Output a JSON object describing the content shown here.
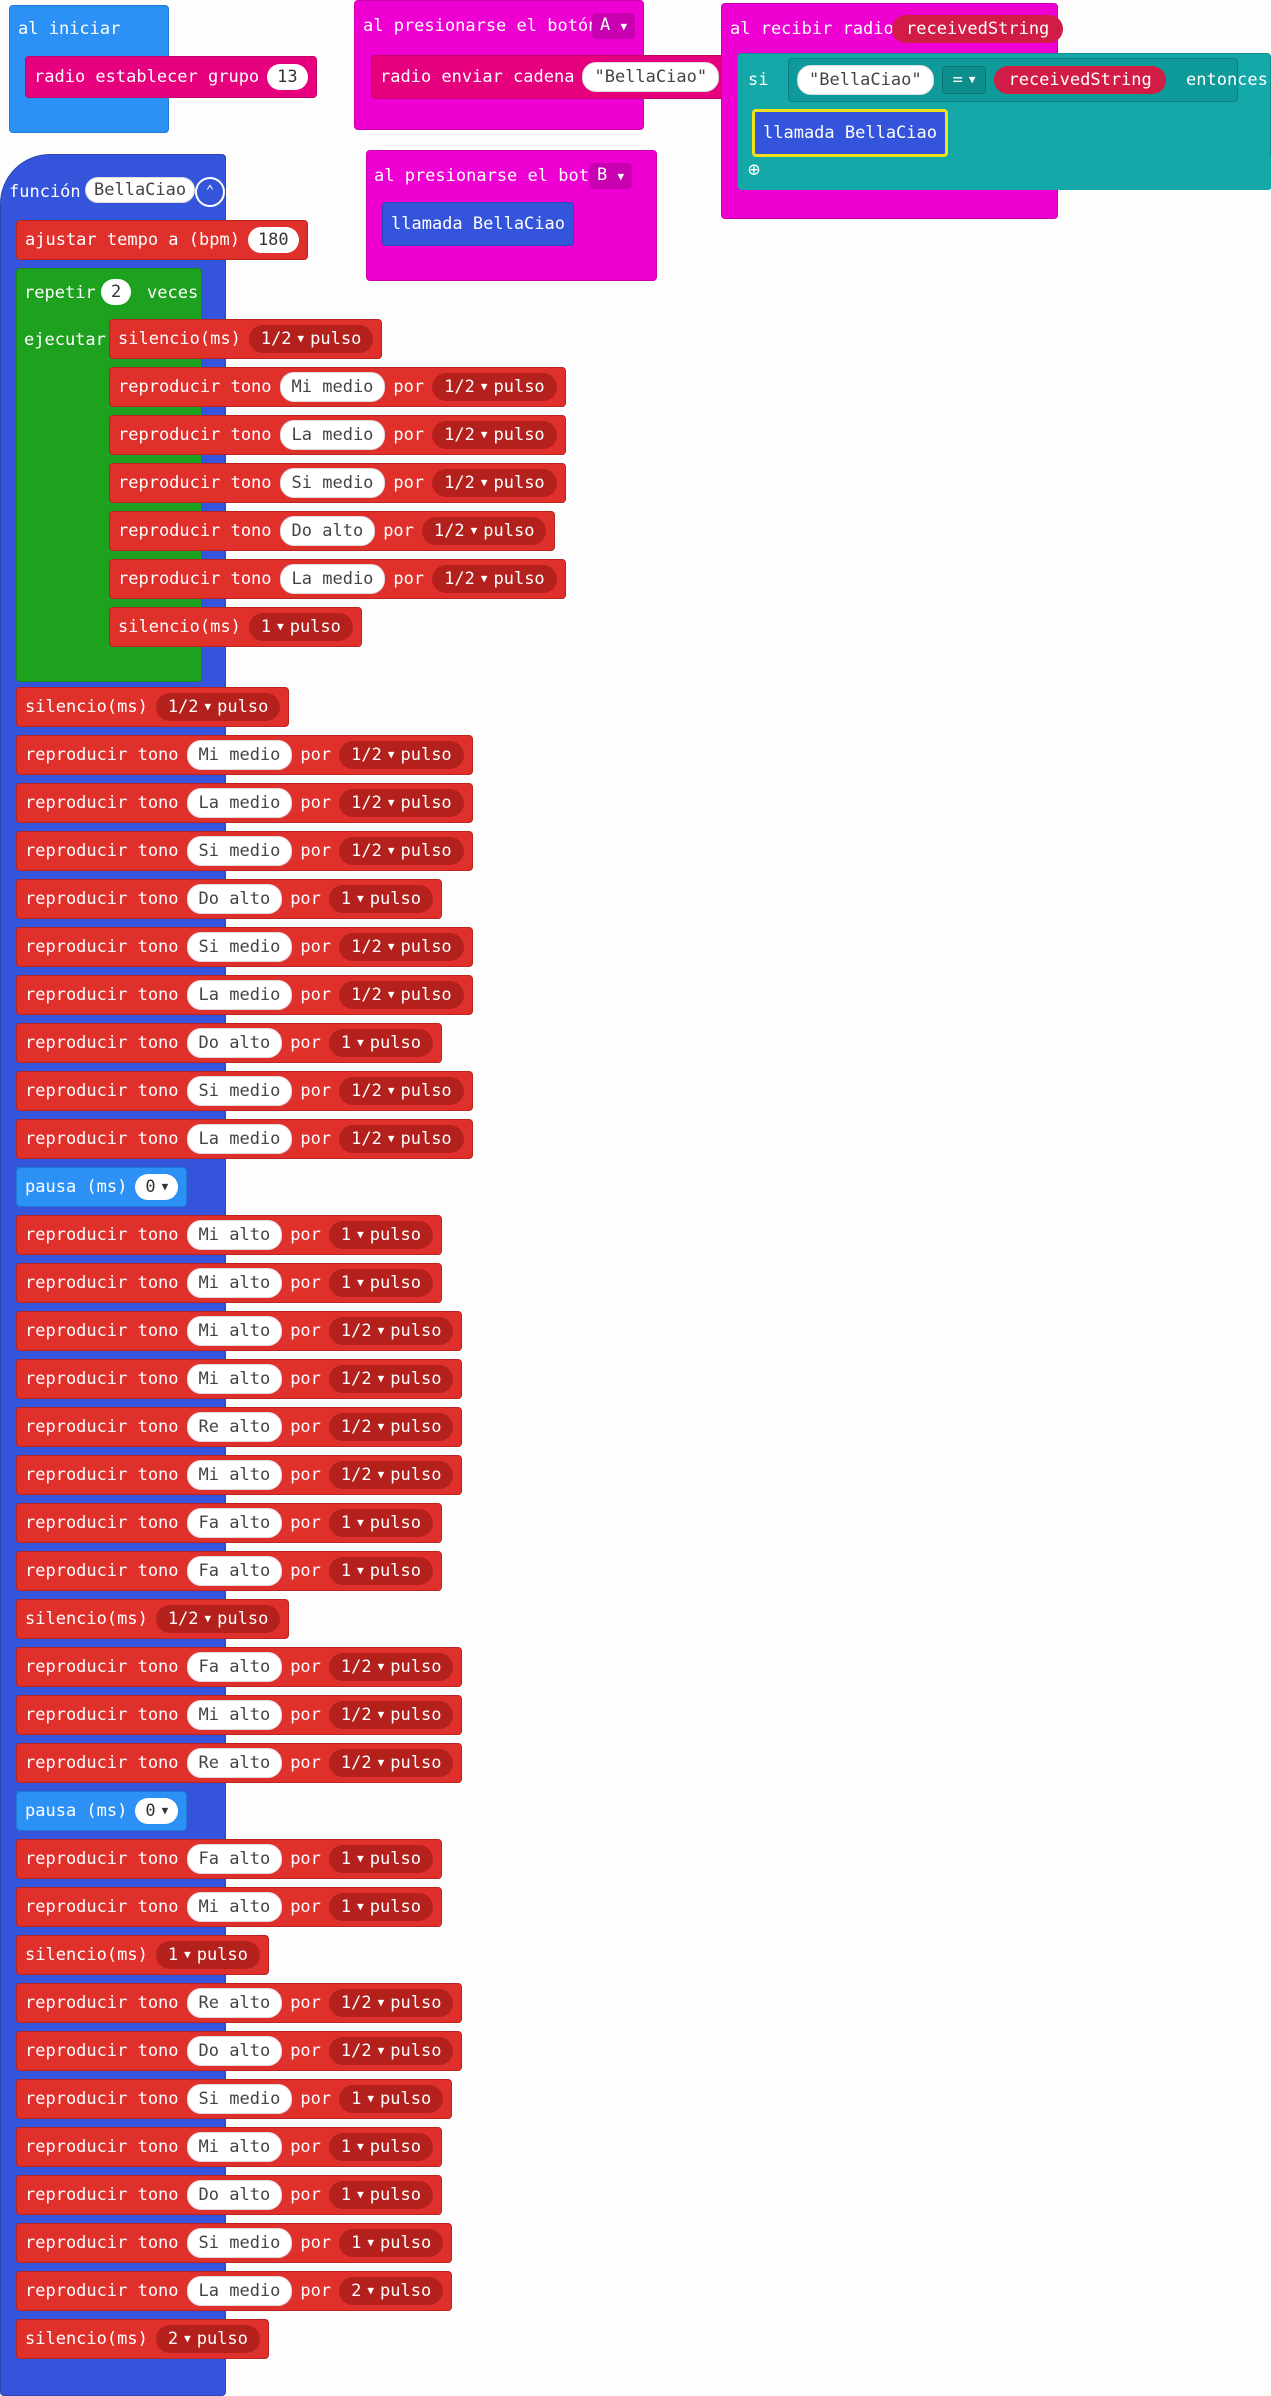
{
  "on_start": {
    "label": "al iniciar",
    "radio_set_group_label": "radio establecer grupo",
    "group_value": "13"
  },
  "button_a": {
    "label": "al presionarse el botón",
    "button": "A",
    "send_label": "radio enviar cadena",
    "send_value": "\"BellaCiao\""
  },
  "button_b": {
    "label": "al presionarse el botón",
    "button": "B",
    "call_label": "llamada BellaCiao"
  },
  "on_radio": {
    "label": "al recibir radio",
    "var": "receivedString",
    "if_label": "si",
    "compare_left": "\"BellaCiao\"",
    "operator": "=",
    "compare_right": "receivedString",
    "then_label": "entonces",
    "call_label": "llamada BellaCiao",
    "add_icon": "plus-circle-icon"
  },
  "function": {
    "label": "función",
    "name": "BellaCiao",
    "collapse_icon": "chevron-up-circle-icon",
    "tempo_label": "ajustar tempo a (bpm)",
    "tempo_value": "180",
    "repeat_label": "repetir",
    "repeat_count": "2",
    "repeat_times": "veces",
    "do_label": "ejecutar"
  },
  "repeat_body": [
    {
      "kind": "rest",
      "label": "silencio(ms)",
      "beat": "1/2",
      "unit": "pulso"
    },
    {
      "kind": "tone",
      "label": "reproducir tono",
      "note": "Mi medio",
      "por": "por",
      "beat": "1/2",
      "unit": "pulso"
    },
    {
      "kind": "tone",
      "label": "reproducir tono",
      "note": "La medio",
      "por": "por",
      "beat": "1/2",
      "unit": "pulso"
    },
    {
      "kind": "tone",
      "label": "reproducir tono",
      "note": "Si medio",
      "por": "por",
      "beat": "1/2",
      "unit": "pulso"
    },
    {
      "kind": "tone",
      "label": "reproducir tono",
      "note": "Do alto",
      "por": "por",
      "beat": "1/2",
      "unit": "pulso"
    },
    {
      "kind": "tone",
      "label": "reproducir tono",
      "note": "La medio",
      "por": "por",
      "beat": "1/2",
      "unit": "pulso"
    },
    {
      "kind": "rest",
      "label": "silencio(ms)",
      "beat": "1",
      "unit": "pulso"
    }
  ],
  "main_body": [
    {
      "kind": "rest",
      "label": "silencio(ms)",
      "beat": "1/2",
      "unit": "pulso"
    },
    {
      "kind": "tone",
      "label": "reproducir tono",
      "note": "Mi medio",
      "por": "por",
      "beat": "1/2",
      "unit": "pulso"
    },
    {
      "kind": "tone",
      "label": "reproducir tono",
      "note": "La medio",
      "por": "por",
      "beat": "1/2",
      "unit": "pulso"
    },
    {
      "kind": "tone",
      "label": "reproducir tono",
      "note": "Si medio",
      "por": "por",
      "beat": "1/2",
      "unit": "pulso"
    },
    {
      "kind": "tone",
      "label": "reproducir tono",
      "note": "Do alto",
      "por": "por",
      "beat": "1",
      "unit": "pulso"
    },
    {
      "kind": "tone",
      "label": "reproducir tono",
      "note": "Si medio",
      "por": "por",
      "beat": "1/2",
      "unit": "pulso"
    },
    {
      "kind": "tone",
      "label": "reproducir tono",
      "note": "La medio",
      "por": "por",
      "beat": "1/2",
      "unit": "pulso"
    },
    {
      "kind": "tone",
      "label": "reproducir tono",
      "note": "Do alto",
      "por": "por",
      "beat": "1",
      "unit": "pulso"
    },
    {
      "kind": "tone",
      "label": "reproducir tono",
      "note": "Si medio",
      "por": "por",
      "beat": "1/2",
      "unit": "pulso"
    },
    {
      "kind": "tone",
      "label": "reproducir tono",
      "note": "La medio",
      "por": "por",
      "beat": "1/2",
      "unit": "pulso"
    },
    {
      "kind": "pause",
      "label": "pausa (ms)",
      "value": "0"
    },
    {
      "kind": "tone",
      "label": "reproducir tono",
      "note": "Mi alto",
      "por": "por",
      "beat": "1",
      "unit": "pulso"
    },
    {
      "kind": "tone",
      "label": "reproducir tono",
      "note": "Mi alto",
      "por": "por",
      "beat": "1",
      "unit": "pulso"
    },
    {
      "kind": "tone",
      "label": "reproducir tono",
      "note": "Mi alto",
      "por": "por",
      "beat": "1/2",
      "unit": "pulso"
    },
    {
      "kind": "tone",
      "label": "reproducir tono",
      "note": "Mi alto",
      "por": "por",
      "beat": "1/2",
      "unit": "pulso"
    },
    {
      "kind": "tone",
      "label": "reproducir tono",
      "note": "Re alto",
      "por": "por",
      "beat": "1/2",
      "unit": "pulso"
    },
    {
      "kind": "tone",
      "label": "reproducir tono",
      "note": "Mi alto",
      "por": "por",
      "beat": "1/2",
      "unit": "pulso"
    },
    {
      "kind": "tone",
      "label": "reproducir tono",
      "note": "Fa alto",
      "por": "por",
      "beat": "1",
      "unit": "pulso"
    },
    {
      "kind": "tone",
      "label": "reproducir tono",
      "note": "Fa alto",
      "por": "por",
      "beat": "1",
      "unit": "pulso"
    },
    {
      "kind": "rest",
      "label": "silencio(ms)",
      "beat": "1/2",
      "unit": "pulso"
    },
    {
      "kind": "tone",
      "label": "reproducir tono",
      "note": "Fa alto",
      "por": "por",
      "beat": "1/2",
      "unit": "pulso"
    },
    {
      "kind": "tone",
      "label": "reproducir tono",
      "note": "Mi alto",
      "por": "por",
      "beat": "1/2",
      "unit": "pulso"
    },
    {
      "kind": "tone",
      "label": "reproducir tono",
      "note": "Re alto",
      "por": "por",
      "beat": "1/2",
      "unit": "pulso"
    },
    {
      "kind": "pause",
      "label": "pausa (ms)",
      "value": "0"
    },
    {
      "kind": "tone",
      "label": "reproducir tono",
      "note": "Fa alto",
      "por": "por",
      "beat": "1",
      "unit": "pulso"
    },
    {
      "kind": "tone",
      "label": "reproducir tono",
      "note": "Mi alto",
      "por": "por",
      "beat": "1",
      "unit": "pulso"
    },
    {
      "kind": "rest",
      "label": "silencio(ms)",
      "beat": "1",
      "unit": "pulso"
    },
    {
      "kind": "tone",
      "label": "reproducir tono",
      "note": "Re alto",
      "por": "por",
      "beat": "1/2",
      "unit": "pulso"
    },
    {
      "kind": "tone",
      "label": "reproducir tono",
      "note": "Do alto",
      "por": "por",
      "beat": "1/2",
      "unit": "pulso"
    },
    {
      "kind": "tone",
      "label": "reproducir tono",
      "note": "Si medio",
      "por": "por",
      "beat": "1",
      "unit": "pulso"
    },
    {
      "kind": "tone",
      "label": "reproducir tono",
      "note": "Mi alto",
      "por": "por",
      "beat": "1",
      "unit": "pulso"
    },
    {
      "kind": "tone",
      "label": "reproducir tono",
      "note": "Do alto",
      "por": "por",
      "beat": "1",
      "unit": "pulso"
    },
    {
      "kind": "tone",
      "label": "reproducir tono",
      "note": "Si medio",
      "por": "por",
      "beat": "1",
      "unit": "pulso"
    },
    {
      "kind": "tone",
      "label": "reproducir tono",
      "note": "La medio",
      "por": "por",
      "beat": "2",
      "unit": "pulso"
    },
    {
      "kind": "rest",
      "label": "silencio(ms)",
      "beat": "2",
      "unit": "pulso"
    }
  ]
}
